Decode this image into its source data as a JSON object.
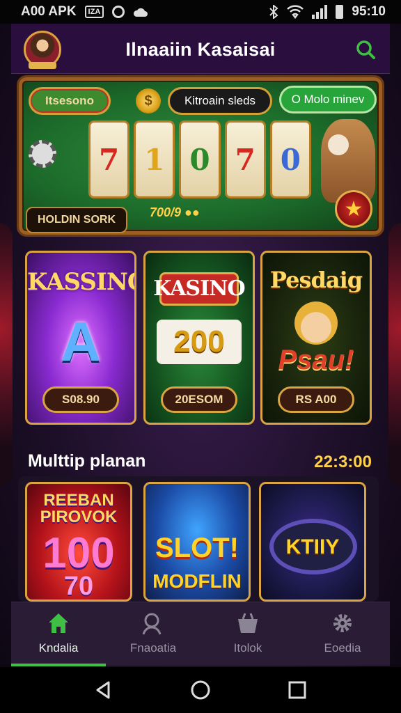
{
  "status_bar": {
    "left_text": "A00 APK",
    "left_badge": "IZA",
    "time": "95:10"
  },
  "header": {
    "title": "Ilnaaiin Kasaisai"
  },
  "hero": {
    "pill_left": "Itsesono",
    "pill_center": "Kitroain sleds",
    "pill_right": "O Molo minev",
    "coin_symbol": "$",
    "reels": [
      "7",
      "1",
      "0",
      "7",
      "0"
    ],
    "hold_button": "HOLDIN SORK",
    "counter": "700/9 ●●"
  },
  "games": [
    {
      "title": "KASSINO",
      "big": "A",
      "value": "S08.90"
    },
    {
      "title": "KASINO",
      "big": "200",
      "value": "20ESOM"
    },
    {
      "title": "Pesdaig",
      "big": "Psau!",
      "value": "RS A00"
    }
  ],
  "section": {
    "title": "Multtip planan",
    "time": "22:3:00",
    "cards": [
      {
        "title": "REEBAN PIROVOK",
        "big": "100",
        "sub": "70"
      },
      {
        "title": "SLOT!",
        "sub": "MODFLIN"
      },
      {
        "title": "KTIIY"
      }
    ]
  },
  "nav": [
    {
      "label": "Kndalia"
    },
    {
      "label": "Fnaoatia"
    },
    {
      "label": "Itolok"
    },
    {
      "label": "Eoedia"
    }
  ],
  "colors": {
    "accent_green": "#3fbf44",
    "gold": "#d9a441",
    "header_bg": "#2a0f3e"
  }
}
